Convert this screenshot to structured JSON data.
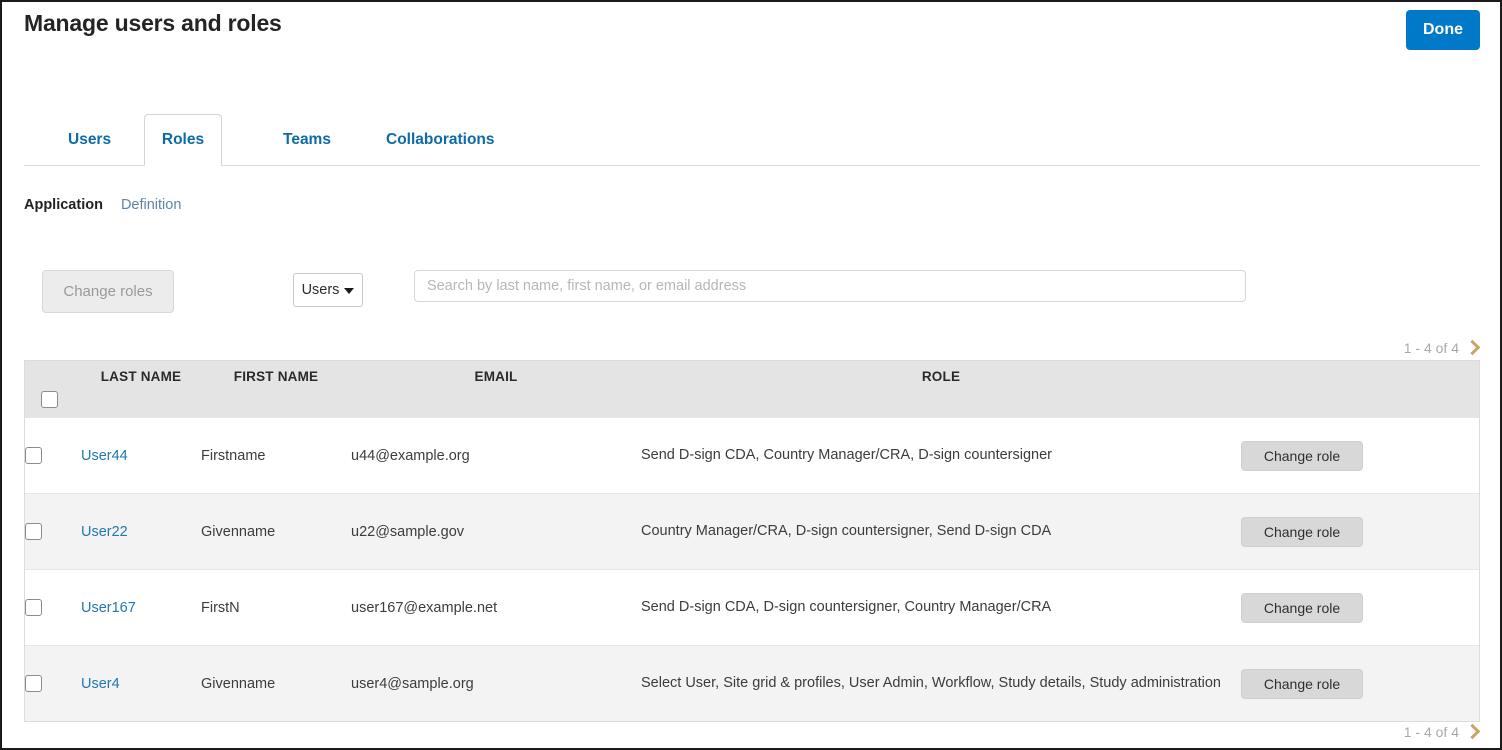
{
  "header": {
    "title": "Manage users and roles",
    "done_label": "Done",
    "accent_color": "#0079c8"
  },
  "tabs": [
    {
      "label": "Users",
      "active": false
    },
    {
      "label": "Roles",
      "active": true
    },
    {
      "label": "Teams",
      "active": false
    },
    {
      "label": "Collaborations",
      "active": false
    }
  ],
  "subnav": [
    {
      "label": "Application",
      "active": true
    },
    {
      "label": "Definition",
      "active": false
    }
  ],
  "toolbar": {
    "change_roles_label": "Change roles",
    "scope_select_value": "Users",
    "search_value": "",
    "search_placeholder": "Search by last name, first name, or email address"
  },
  "pagination": {
    "range_label": "1 - 4 of 4",
    "next_icon": "chevron-right-icon"
  },
  "table": {
    "columns": [
      "LAST NAME",
      "FIRST NAME",
      "EMAIL",
      "ROLE"
    ],
    "action_label": "Change role",
    "rows": [
      {
        "last_name": "User44",
        "first_name": "Firstname",
        "email": "u44@example.org",
        "role": "Send D-sign CDA, Country Manager/CRA, D-sign countersigner"
      },
      {
        "last_name": "User22",
        "first_name": "Givenname",
        "email": "u22@sample.gov",
        "role": "Country Manager/CRA, D-sign countersigner, Send D-sign CDA"
      },
      {
        "last_name": "User167",
        "first_name": "FirstN",
        "email": "user167@example.net",
        "role": "Send D-sign CDA, D-sign countersigner, Country Manager/CRA"
      },
      {
        "last_name": "User4",
        "first_name": "Givenname",
        "email": "user4@sample.org",
        "role": "Select User, Site grid & profiles, User Admin, Workflow, Study details, Study administration"
      }
    ]
  }
}
